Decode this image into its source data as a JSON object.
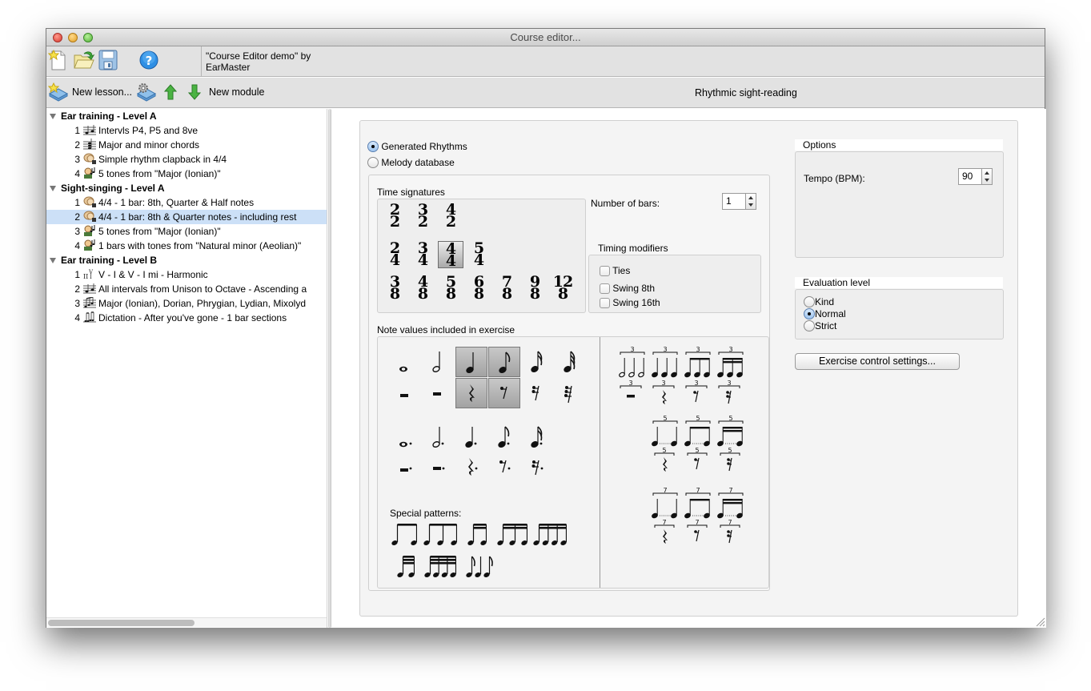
{
  "window": {
    "title": "Course editor..."
  },
  "toolbar": {
    "icons": [
      "new-document-icon",
      "open-folder-icon",
      "save-floppy-icon",
      "help-icon"
    ],
    "course_title": "\"Course Editor demo\" by EarMaster"
  },
  "lesson_toolbar": {
    "new_lesson_label": "New lesson...",
    "new_module_label": "New module",
    "icons": [
      "new-lesson-icon",
      "lesson-settings-icon",
      "move-up-icon",
      "move-down-icon"
    ]
  },
  "panel_title": "Rhythmic sight-reading",
  "tree": [
    {
      "type": "group",
      "label": "Ear training - Level A"
    },
    {
      "type": "item",
      "num": "1",
      "icon": "intervals-icon",
      "label": "Intervls P4, P5 and 8ve"
    },
    {
      "type": "item",
      "num": "2",
      "icon": "chords-icon",
      "label": "Major and minor chords"
    },
    {
      "type": "item",
      "num": "3",
      "icon": "clap-icon",
      "label": "Simple rhythm clapback in 4/4"
    },
    {
      "type": "item",
      "num": "4",
      "icon": "singer-icon",
      "label": "5 tones from \"Major (Ionian)\""
    },
    {
      "type": "group",
      "label": "Sight-singing - Level A"
    },
    {
      "type": "item",
      "num": "1",
      "icon": "clap-icon",
      "label": "4/4 - 1 bar: 8th, Quarter & Half notes"
    },
    {
      "type": "item",
      "num": "2",
      "icon": "clap-icon",
      "label": "4/4 - 1 bar: 8th & Quarter notes - including rest",
      "selected": true
    },
    {
      "type": "item",
      "num": "3",
      "icon": "singer-icon",
      "label": "5 tones from \"Major (Ionian)\""
    },
    {
      "type": "item",
      "num": "4",
      "icon": "singer-icon",
      "label": "1 bars with tones from \"Natural minor (Aeolian)\""
    },
    {
      "type": "group",
      "label": "Ear training - Level B"
    },
    {
      "type": "item",
      "num": "1",
      "icon": "harmony-icon",
      "label": "V - I & V - I mi - Harmonic"
    },
    {
      "type": "item",
      "num": "2",
      "icon": "intervals-icon",
      "label": "All intervals from Unison to Octave - Ascending a"
    },
    {
      "type": "item",
      "num": "3",
      "icon": "scales-icon",
      "label": "Major (Ionian), Dorian, Phrygian, Lydian, Mixolyd"
    },
    {
      "type": "item",
      "num": "4",
      "icon": "dictation-icon",
      "label": "Dictation - After you've gone - 1 bar sections"
    }
  ],
  "source": {
    "options": [
      {
        "label": "Generated Rhythms",
        "checked": true
      },
      {
        "label": "Melody database",
        "checked": false
      }
    ]
  },
  "time_signatures": {
    "label": "Time signatures",
    "rows": [
      [
        {
          "top": "2",
          "bottom": "2"
        },
        {
          "top": "3",
          "bottom": "2"
        },
        {
          "top": "4",
          "bottom": "2"
        }
      ],
      [
        {
          "top": "2",
          "bottom": "4"
        },
        {
          "top": "3",
          "bottom": "4"
        },
        {
          "top": "4",
          "bottom": "4",
          "selected": true
        },
        {
          "top": "5",
          "bottom": "4"
        }
      ],
      [
        {
          "top": "3",
          "bottom": "8"
        },
        {
          "top": "4",
          "bottom": "8"
        },
        {
          "top": "5",
          "bottom": "8"
        },
        {
          "top": "6",
          "bottom": "8"
        },
        {
          "top": "7",
          "bottom": "8"
        },
        {
          "top": "9",
          "bottom": "8"
        },
        {
          "top": "12",
          "bottom": "8"
        }
      ]
    ]
  },
  "number_of_bars": {
    "label": "Number of bars:",
    "value": "1"
  },
  "timing_modifiers": {
    "label": "Timing modifiers",
    "items": [
      {
        "label": "Ties",
        "checked": false
      },
      {
        "label": "Swing 8th",
        "checked": false
      },
      {
        "label": "Swing 16th",
        "checked": false
      }
    ]
  },
  "note_values": {
    "label": "Note values included in exercise",
    "notes": [
      "whole",
      "half",
      "quarter",
      "eighth",
      "sixteenth",
      "thirty-second"
    ],
    "rests": [
      "whole-rest",
      "half-rest",
      "quarter-rest",
      "eighth-rest",
      "sixteenth-rest",
      "thirty-second-rest"
    ],
    "selected_notes": [
      "quarter",
      "eighth"
    ],
    "selected_rests": [
      "quarter-rest",
      "eighth-rest"
    ],
    "dotted_notes": [
      "dotted-whole",
      "dotted-half",
      "dotted-quarter",
      "dotted-eighth",
      "dotted-sixteenth"
    ],
    "dotted_rests": [
      "dotted-whole-rest",
      "dotted-half-rest",
      "dotted-quarter-rest",
      "dotted-eighth-rest",
      "dotted-sixteenth-rest"
    ],
    "special_patterns_label": "Special patterns:",
    "special_patterns": [
      "two-eighths",
      "three-eighths",
      "two-sixteenths",
      "three-sixteenths",
      "four-sixteenths",
      "two-thirty-seconds",
      "four-thirty-seconds",
      "eighth-quarter-eighth"
    ],
    "tuplets": {
      "triplet_label": "3",
      "quintuplet_label": "5",
      "septuplet_label": "7"
    }
  },
  "options": {
    "label": "Options",
    "tempo_label": "Tempo (BPM):",
    "tempo_value": "90"
  },
  "evaluation": {
    "label": "Evaluation level",
    "levels": [
      {
        "label": "Kind",
        "checked": false
      },
      {
        "label": "Normal",
        "checked": true
      },
      {
        "label": "Strict",
        "checked": false
      }
    ]
  },
  "exercise_control_button": "Exercise control settings..."
}
